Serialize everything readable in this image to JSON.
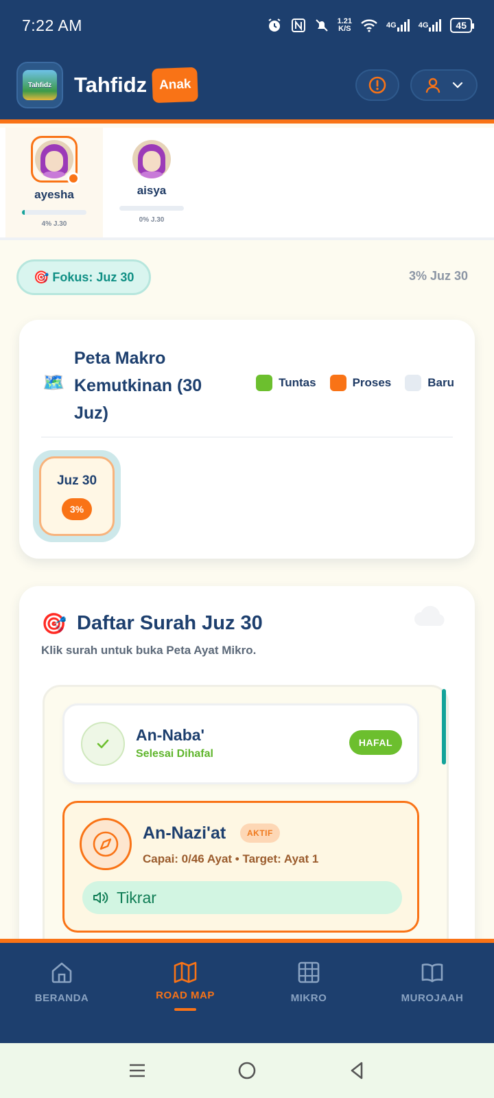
{
  "status_bar": {
    "time": "7:22 AM",
    "net_speed_value": "1.21",
    "net_speed_unit": "K/S",
    "signal1": "4G",
    "signal2": "4G",
    "battery": "45"
  },
  "header": {
    "logo_text": "Tahfidz",
    "app_title": "Tahfidz",
    "badge": "Anak"
  },
  "children": [
    {
      "name": "ayesha",
      "progress": 0.04,
      "progress_label": "4% J.30",
      "active": true
    },
    {
      "name": "aisya",
      "progress": 0.0,
      "progress_label": "0% J.30",
      "active": false
    }
  ],
  "focus": {
    "label": "🎯 Fokus: Juz 30",
    "summary": "3% Juz 30"
  },
  "macro_map": {
    "icon": "🗺️",
    "title": "Peta Makro Kemutkinan (30 Juz)",
    "legend": [
      {
        "label": "Tuntas",
        "color": "#6cbf2e"
      },
      {
        "label": "Proses",
        "color": "#f97316"
      },
      {
        "label": "Baru",
        "color": "#e5ebf2"
      }
    ],
    "juz_tiles": [
      {
        "label": "Juz 30",
        "percent": "3%"
      }
    ]
  },
  "surah_list": {
    "icon": "🎯",
    "title": "Daftar Surah Juz 30",
    "subtitle": "Klik surah untuk buka Peta Ayat Mikro.",
    "items": [
      {
        "name": "An-Naba'",
        "status": "Selesai Dihafal",
        "badge": "HAFAL"
      },
      {
        "name": "An-Nazi'at",
        "badge": "AKTIF",
        "progress_text": "Capai: 0/46 Ayat • Target: Ayat 1",
        "action": "Tikrar"
      }
    ]
  },
  "bottom_nav": [
    {
      "label": "BERANDA",
      "icon": "home-icon"
    },
    {
      "label": "ROAD MAP",
      "icon": "map-icon",
      "active": true
    },
    {
      "label": "MIKRO",
      "icon": "grid-icon"
    },
    {
      "label": "MUROJAAH",
      "icon": "book-icon"
    }
  ],
  "colors": {
    "primary": "#1d3f6e",
    "accent": "#f97316",
    "teal": "#14a39a",
    "success": "#6cbf2e"
  }
}
